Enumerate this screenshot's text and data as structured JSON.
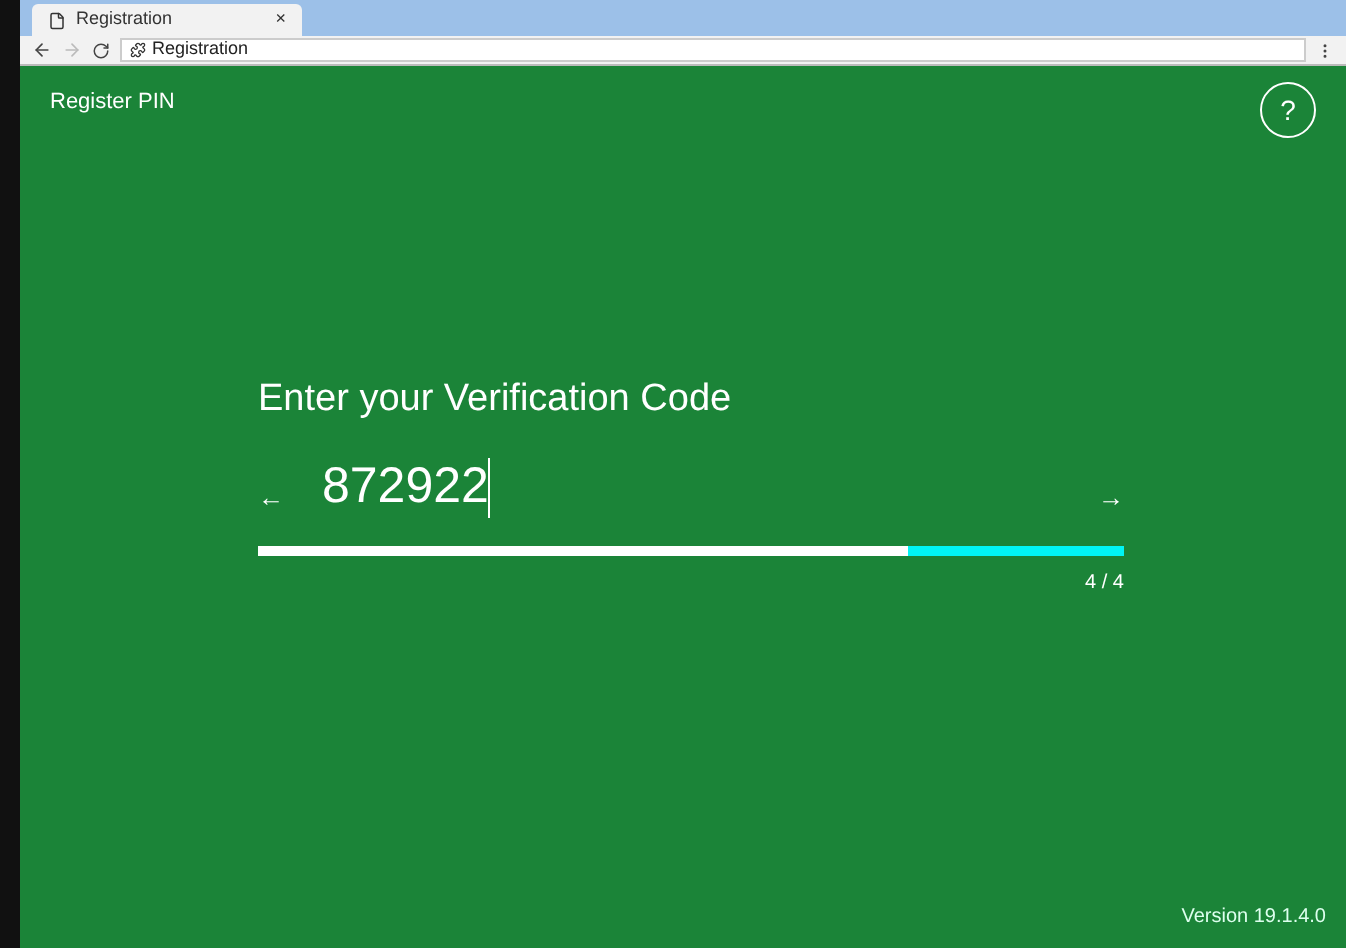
{
  "browser": {
    "tab_title": "Registration",
    "tab_close": "×",
    "address": "Registration"
  },
  "header": {
    "title": "Register PIN",
    "help": "?"
  },
  "form": {
    "prompt": "Enter your Verification Code",
    "value": "872922",
    "back": "←",
    "next": "→",
    "progress": {
      "level": 0.75
    },
    "step": "4 / 4"
  },
  "footer": {
    "version": "Version 19.1.4.0"
  }
}
